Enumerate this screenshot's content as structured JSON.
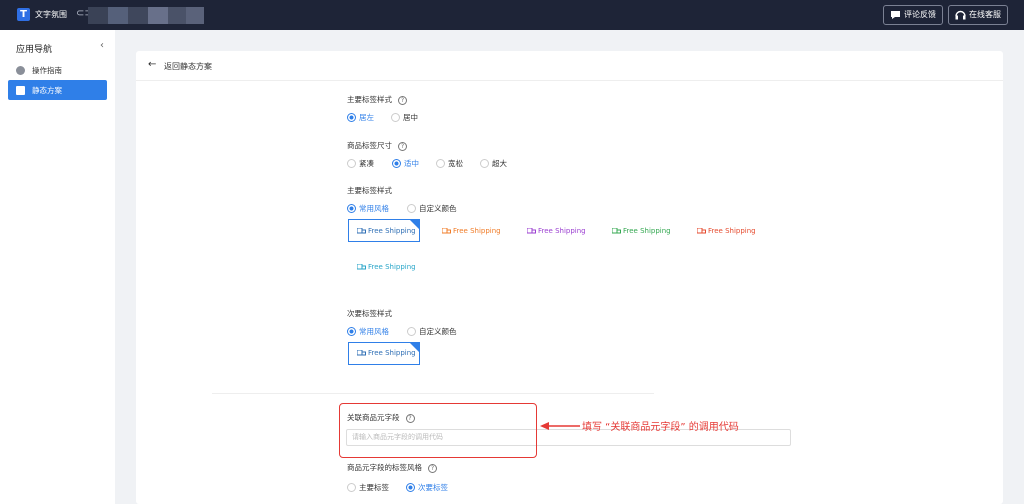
{
  "topbar": {
    "app_name": "文字氛围",
    "logo_letter": "T",
    "feedback_label": "评论反馈",
    "service_label": "在线客服"
  },
  "sidebar": {
    "title": "应用导航",
    "items": [
      {
        "label": "操作指南",
        "active": false
      },
      {
        "label": "静态方案",
        "active": true
      }
    ]
  },
  "header": {
    "back_label": "返回静态方案"
  },
  "form": {
    "primary_position": {
      "label": "主要标签样式",
      "options": [
        "居左",
        "居中"
      ],
      "selected": "居左"
    },
    "tag_size": {
      "label": "商品标签尺寸",
      "options": [
        "紧凑",
        "适中",
        "宽松",
        "超大"
      ],
      "selected": "适中"
    },
    "primary_style": {
      "label": "主要标签样式",
      "options": [
        "常用风格",
        "自定义颜色"
      ],
      "selected": "常用风格",
      "presets": [
        {
          "text": "Free Shipping",
          "color": "#2f6fb5"
        },
        {
          "text": "Free Shipping",
          "color": "#f07c28"
        },
        {
          "text": "Free Shipping",
          "color": "#9b3fd1"
        },
        {
          "text": "Free Shipping",
          "color": "#35a852"
        },
        {
          "text": "Free Shipping",
          "color": "#e54b2f"
        },
        {
          "text": "Free Shipping",
          "color": "#2aa6c9"
        }
      ]
    },
    "secondary_style": {
      "label": "次要标签样式",
      "options": [
        "常用风格",
        "自定义颜色"
      ],
      "selected": "常用风格",
      "preset": {
        "text": "Free Shipping",
        "color": "#2f6fb5"
      }
    },
    "meta_field": {
      "label": "关联商品元字段",
      "placeholder": "请输入商品元字段的调用代码"
    },
    "meta_style": {
      "label": "商品元字段的标签风格",
      "options": [
        "主要标签",
        "次要标签"
      ],
      "selected": "次要标签"
    }
  },
  "annotation": {
    "text": "填写 “关联商品元字段” 的调用代码",
    "color": "#e53935"
  },
  "colors": {
    "topbar": "#1e2437",
    "accent": "#2f7fe8"
  }
}
